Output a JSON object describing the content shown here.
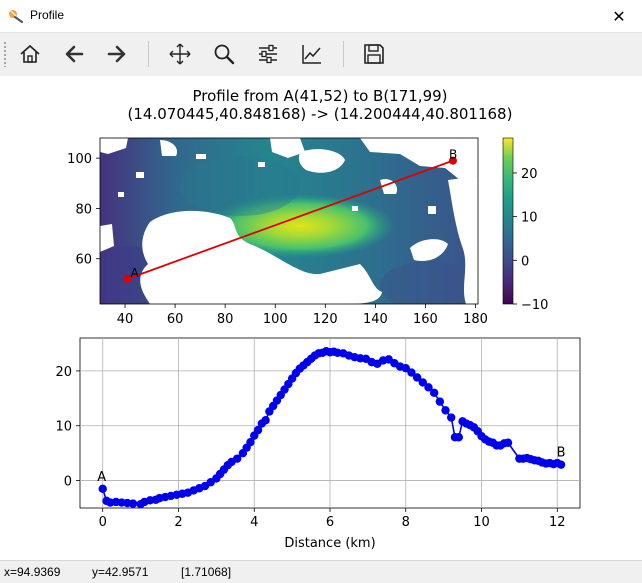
{
  "window": {
    "title": "Profile",
    "close_glyph": "✕"
  },
  "toolbar": {
    "buttons": [
      {
        "name": "home-icon",
        "label": "Home"
      },
      {
        "name": "back-arrow-icon",
        "label": "Back"
      },
      {
        "name": "forward-arrow-icon",
        "label": "Forward"
      },
      {
        "name": "pan-icon",
        "label": "Pan"
      },
      {
        "name": "zoom-icon",
        "label": "Zoom"
      },
      {
        "name": "configure-subplots-icon",
        "label": "Subplots"
      },
      {
        "name": "edit-axes-icon",
        "label": "Customize"
      },
      {
        "name": "save-icon",
        "label": "Save"
      }
    ]
  },
  "figure": {
    "title_line1": "Profile from A(41,52) to B(171,99)",
    "title_line2": "(14.070445,40.848168) -> (14.200444,40.801168)"
  },
  "chart_data": [
    {
      "type": "heatmap",
      "x_ticks": [
        "40",
        "60",
        "80",
        "100",
        "120",
        "140",
        "160",
        "180"
      ],
      "y_ticks": [
        "60",
        "80",
        "100"
      ],
      "xlim": [
        30,
        181
      ],
      "ylim": [
        108,
        42
      ],
      "colormap": "viridis",
      "colorbar": {
        "ticks": [
          "20",
          "10",
          "0",
          "−10"
        ],
        "range": [
          -10,
          28
        ]
      },
      "profile_line": {
        "A": [
          41,
          52
        ],
        "B": [
          171,
          99
        ],
        "color": "#dd0000"
      },
      "point_labels": [
        "A",
        "B"
      ]
    },
    {
      "type": "scatter",
      "xlabel": "Distance (km)",
      "x_ticks": [
        "0",
        "2",
        "4",
        "6",
        "8",
        "10",
        "12"
      ],
      "y_ticks": [
        "20",
        "10",
        "0"
      ],
      "xlim": [
        -0.6,
        12.6
      ],
      "ylim": [
        -5,
        26
      ],
      "grid": true,
      "color": "#0000ee",
      "point_labels": [
        "A",
        "B"
      ],
      "x": [
        0.0,
        0.1,
        0.2,
        0.35,
        0.5,
        0.65,
        0.8,
        1.0,
        1.1,
        1.25,
        1.4,
        1.5,
        1.65,
        1.8,
        1.95,
        2.1,
        2.25,
        2.4,
        2.55,
        2.7,
        2.85,
        3.0,
        3.1,
        3.2,
        3.3,
        3.4,
        3.55,
        3.7,
        3.8,
        3.9,
        4.0,
        4.1,
        4.2,
        4.3,
        4.4,
        4.5,
        4.6,
        4.7,
        4.8,
        4.9,
        5.0,
        5.1,
        5.2,
        5.3,
        5.4,
        5.5,
        5.6,
        5.7,
        5.8,
        5.9,
        6.0,
        6.1,
        6.2,
        6.35,
        6.5,
        6.65,
        6.8,
        6.95,
        7.1,
        7.25,
        7.4,
        7.55,
        7.7,
        7.85,
        8.0,
        8.15,
        8.3,
        8.45,
        8.6,
        8.75,
        8.9,
        9.05,
        9.2,
        9.3,
        9.4,
        9.5,
        9.6,
        9.7,
        9.8,
        9.9,
        10.0,
        10.1,
        10.2,
        10.3,
        10.4,
        10.5,
        10.6,
        10.7,
        11.0,
        11.1,
        11.2,
        11.3,
        11.4,
        11.5,
        11.6,
        11.7,
        11.8,
        11.9,
        12.0,
        12.1
      ],
      "y": [
        -1.5,
        -3.7,
        -4.0,
        -3.9,
        -4.0,
        -4.1,
        -4.2,
        -4.3,
        -3.9,
        -3.6,
        -3.5,
        -3.2,
        -3.0,
        -2.8,
        -2.6,
        -2.4,
        -2.2,
        -1.8,
        -1.4,
        -1.0,
        -0.3,
        0.4,
        1.2,
        2.0,
        2.8,
        3.4,
        4.0,
        5.0,
        6.0,
        7.0,
        8.2,
        9.2,
        10.4,
        11.0,
        12.6,
        13.6,
        14.6,
        15.6,
        16.6,
        17.6,
        18.6,
        19.6,
        20.4,
        21.0,
        21.6,
        22.2,
        22.8,
        23.2,
        23.3,
        23.6,
        23.4,
        23.5,
        23.3,
        23.2,
        22.8,
        22.5,
        22.3,
        22.2,
        21.6,
        21.3,
        21.9,
        22.1,
        21.4,
        20.8,
        20.5,
        19.7,
        18.8,
        17.9,
        17.0,
        16.0,
        14.4,
        12.8,
        11.5,
        7.9,
        7.9,
        10.8,
        10.4,
        10.1,
        9.7,
        9.0,
        8.1,
        7.5,
        7.1,
        6.9,
        6.4,
        6.4,
        6.8,
        6.9,
        4.0,
        4.0,
        4.1,
        3.9,
        3.7,
        3.6,
        3.3,
        3.1,
        3.2,
        3.0,
        3.2,
        2.9
      ]
    }
  ],
  "status": {
    "x": "x=94.9369",
    "y": "y=42.9571",
    "value": "[1.71068]"
  }
}
